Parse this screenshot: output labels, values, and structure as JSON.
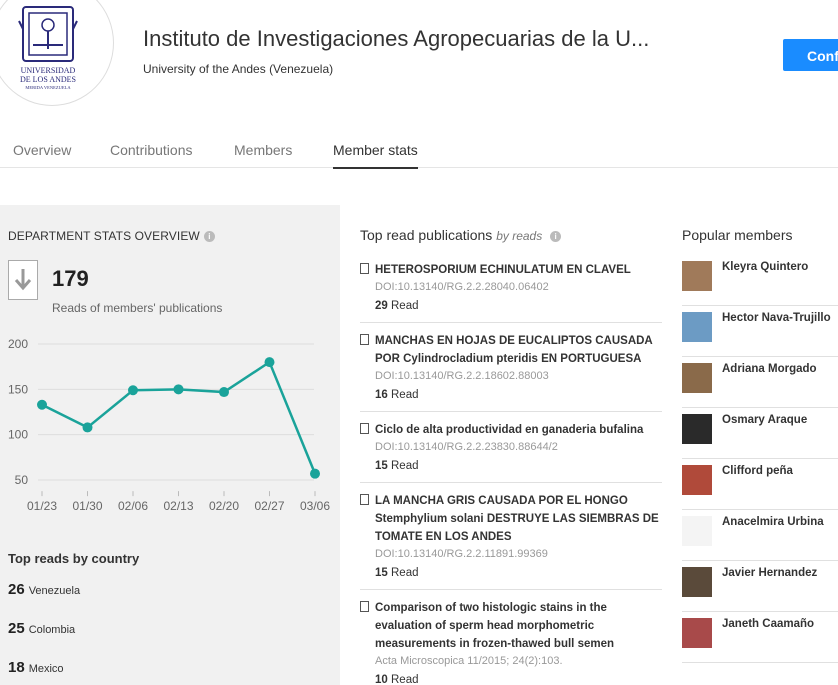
{
  "header": {
    "logo_text_1": "UNIVERSIDAD",
    "logo_text_2": "DE LOS ANDES",
    "logo_text_3": "MERIDA VENEZUELA",
    "title": "Instituto de Investigaciones Agropecuarias de la U...",
    "subtitle": "University of the Andes (Venezuela)",
    "confirm_label": "Conf"
  },
  "tabs": [
    {
      "label": "Overview"
    },
    {
      "label": "Contributions"
    },
    {
      "label": "Members"
    },
    {
      "label": "Member stats"
    }
  ],
  "stats": {
    "title": "DEPARTMENT STATS OVERVIEW",
    "info_glyph": "i",
    "reads_count": "179",
    "reads_label": "Reads of members' publications"
  },
  "chart_data": {
    "type": "line",
    "categories": [
      "01/23",
      "01/30",
      "02/06",
      "02/13",
      "02/20",
      "02/27",
      "03/06"
    ],
    "x": [
      0,
      1,
      2,
      3,
      4,
      5,
      6,
      7
    ],
    "values": [
      133,
      108,
      149,
      150,
      147,
      180,
      57
    ],
    "yticks": [
      200,
      150,
      100,
      50
    ],
    "ylim": [
      40,
      210
    ],
    "grid": true,
    "color": "#1aa39a"
  },
  "countries": {
    "title": "Top reads by country",
    "items": [
      {
        "count": "26",
        "name": "Venezuela"
      },
      {
        "count": "25",
        "name": "Colombia"
      },
      {
        "count": "18",
        "name": "Mexico"
      }
    ]
  },
  "publications": {
    "title": "Top read publications",
    "by": "by reads",
    "info_glyph": "i",
    "read_word": "Read",
    "items": [
      {
        "title": "HETEROSPORIUM ECHINULATUM EN CLAVEL",
        "doi": "DOI:10.13140/RG.2.2.28040.06402",
        "reads": "29"
      },
      {
        "title": "MANCHAS EN HOJAS DE EUCALIPTOS CAUSADA POR Cylindrocladium pteridis EN PORTUGUESA",
        "doi": "DOI:10.13140/RG.2.2.18602.88003",
        "reads": "16"
      },
      {
        "title": "Ciclo de alta productividad en ganaderia bufalina",
        "doi": "DOI:10.13140/RG.2.2.23830.88644/2",
        "reads": "15"
      },
      {
        "title": "LA MANCHA GRIS CAUSADA POR EL HONGO Stemphylium solani DESTRUYE LAS SIEMBRAS DE TOMATE EN LOS ANDES",
        "doi": "DOI:10.13140/RG.2.2.11891.99369",
        "reads": "15"
      },
      {
        "title": "Comparison of two histologic stains in the evaluation of sperm head morphometric measurements in frozen-thawed bull semen",
        "doi": "Acta Microscopica 11/2015; 24(2):103.",
        "reads": "10"
      }
    ]
  },
  "popular": {
    "title": "Popular members",
    "items": [
      {
        "name": "Kleyra Quintero",
        "color": "#a07a5a"
      },
      {
        "name": "Hector Nava-Trujillo",
        "color": "#6c9bc4"
      },
      {
        "name": "Adriana Morgado",
        "color": "#8a6a4a"
      },
      {
        "name": "Osmary Araque",
        "color": "#2a2a2a"
      },
      {
        "name": "Clifford peña",
        "color": "#b04a3a"
      },
      {
        "name": "Anacelmira Urbina",
        "color": "#f4f4f4"
      },
      {
        "name": "Javier Hernandez",
        "color": "#5a4a3a"
      },
      {
        "name": "Janeth Caamaño",
        "color": "#a84a4a"
      }
    ]
  }
}
